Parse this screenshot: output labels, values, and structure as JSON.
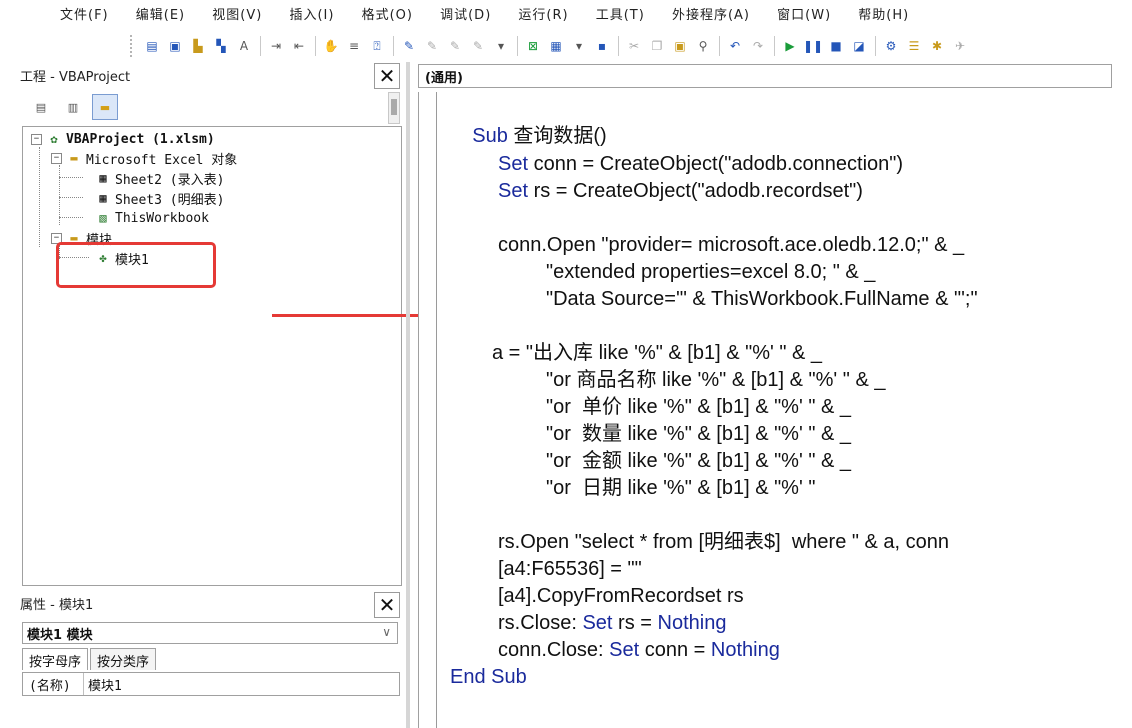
{
  "menu": {
    "items": [
      "文件(F)",
      "编辑(E)",
      "视图(V)",
      "插入(I)",
      "格式(O)",
      "调试(D)",
      "运行(R)",
      "工具(T)",
      "外接程序(A)",
      "窗口(W)",
      "帮助(H)"
    ]
  },
  "project_pane": {
    "title": "工程 - VBAProject",
    "close": "✕",
    "tree": {
      "root": "VBAProject (1.xlsm)",
      "excel_folder": "Microsoft Excel 对象",
      "sheet2": "Sheet2 (录入表)",
      "sheet3": "Sheet3 (明细表)",
      "thisworkbook": "ThisWorkbook",
      "modules_folder": "模块",
      "module1": "模块1"
    }
  },
  "properties_pane": {
    "title": "属性 - 模块1",
    "close": "✕",
    "selected_object": "模块1 模块",
    "tab_alpha": "按字母序",
    "tab_category": "按分类序",
    "row_key": "(名称)",
    "row_value": "模块1"
  },
  "code_window": {
    "object_combo": "(通用)",
    "lines": [
      "Sub 查询数据()",
      "Set conn = CreateObject(\"adodb.connection\")",
      "Set rs = CreateObject(\"adodb.recordset\")",
      "conn.Open \"provider= microsoft.ace.oledb.12.0;\" & _",
      "\"extended properties=excel 8.0; \" & _",
      "\"Data Source='\" & ThisWorkbook.FullName & \"';\"",
      "a = \"出入库 like '%\" & [b1] & \"%' \" & _",
      "\"or 商品名称 like '%\" & [b1] & \"%' \" & _",
      "\"or  单价 like '%\" & [b1] & \"%' \" & _",
      "\"or  数量 like '%\" & [b1] & \"%' \" & _",
      "\"or  金额 like '%\" & [b1] & \"%' \" & _",
      "\"or  日期 like '%\" & [b1] & \"%' \"",
      "rs.Open \"select * from [明细表$]  where \" & a, conn",
      "[a4:F65536] = \"\"",
      "[a4].CopyFromRecordset rs",
      "rs.Close: Set rs = Nothing",
      "conn.Close: Set conn = Nothing",
      "End Sub"
    ]
  }
}
